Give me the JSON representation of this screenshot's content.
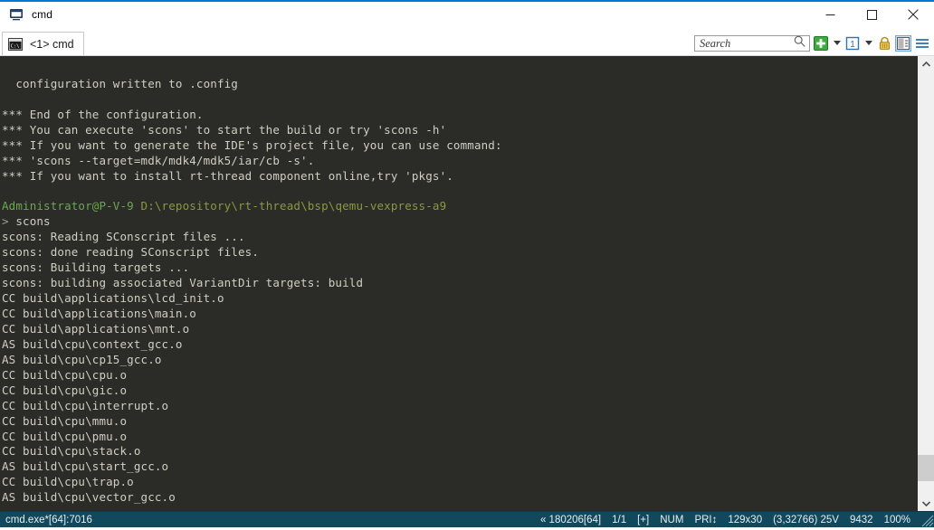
{
  "window": {
    "title": "cmd",
    "title_icon": "console-icon",
    "controls": {
      "minimize": "minimize-icon",
      "maximize": "maximize-icon",
      "close": "close-icon"
    }
  },
  "tabs": [
    {
      "label": "<1> cmd",
      "icon": "console-tab-icon",
      "active": true
    }
  ],
  "toolbar": {
    "search": {
      "placeholder": "Search",
      "value": "",
      "icon": "search-icon"
    },
    "new_console": {
      "icon": "green-plus-icon",
      "dropdown": "chevron-down-icon"
    },
    "active_console": {
      "label": "1",
      "icon": "console-number-icon",
      "dropdown": "chevron-down-icon"
    },
    "lock": {
      "icon": "lock-icon"
    },
    "panels": {
      "icon": "split-panel-icon",
      "selected": true
    },
    "menu": {
      "icon": "hamburger-menu-icon"
    }
  },
  "terminal": {
    "background": "#2b2b28",
    "foreground": "#cfcfc2",
    "prompt_color": "#6aa84f",
    "lines": [
      {
        "segments": [
          {
            "text": "",
            "class": "c-default"
          }
        ]
      },
      {
        "segments": [
          {
            "text": "  configuration written to .config",
            "class": "c-default"
          }
        ]
      },
      {
        "segments": [
          {
            "text": "",
            "class": "c-default"
          }
        ]
      },
      {
        "segments": [
          {
            "text": "*** End of the configuration.",
            "class": "c-default"
          }
        ]
      },
      {
        "segments": [
          {
            "text": "*** You can execute 'scons' to start the build or try 'scons -h'",
            "class": "c-default"
          }
        ]
      },
      {
        "segments": [
          {
            "text": "*** If you want to generate the IDE's project file, you can use command:",
            "class": "c-default"
          }
        ]
      },
      {
        "segments": [
          {
            "text": "*** 'scons --target=mdk/mdk4/mdk5/iar/cb -s'.",
            "class": "c-default"
          }
        ]
      },
      {
        "segments": [
          {
            "text": "*** If you want to install rt-thread component online,try 'pkgs'.",
            "class": "c-default"
          }
        ]
      },
      {
        "segments": [
          {
            "text": "",
            "class": "c-default"
          }
        ]
      },
      {
        "segments": [
          {
            "text": "Administrator@P-V-9",
            "class": "c-green"
          },
          {
            "text": " ",
            "class": "c-default"
          },
          {
            "text": "D:\\repository\\rt-thread\\bsp\\qemu-vexpress-a9",
            "class": "c-olive"
          }
        ]
      },
      {
        "segments": [
          {
            "text": "> ",
            "class": "c-gray"
          },
          {
            "text": "scons",
            "class": "c-default"
          }
        ]
      },
      {
        "segments": [
          {
            "text": "scons: Reading SConscript files ...",
            "class": "c-default"
          }
        ]
      },
      {
        "segments": [
          {
            "text": "scons: done reading SConscript files.",
            "class": "c-default"
          }
        ]
      },
      {
        "segments": [
          {
            "text": "scons: Building targets ...",
            "class": "c-default"
          }
        ]
      },
      {
        "segments": [
          {
            "text": "scons: building associated VariantDir targets: build",
            "class": "c-default"
          }
        ]
      },
      {
        "segments": [
          {
            "text": "CC build\\applications\\lcd_init.o",
            "class": "c-default"
          }
        ]
      },
      {
        "segments": [
          {
            "text": "CC build\\applications\\main.o",
            "class": "c-default"
          }
        ]
      },
      {
        "segments": [
          {
            "text": "CC build\\applications\\mnt.o",
            "class": "c-default"
          }
        ]
      },
      {
        "segments": [
          {
            "text": "AS build\\cpu\\context_gcc.o",
            "class": "c-default"
          }
        ]
      },
      {
        "segments": [
          {
            "text": "AS build\\cpu\\cp15_gcc.o",
            "class": "c-default"
          }
        ]
      },
      {
        "segments": [
          {
            "text": "CC build\\cpu\\cpu.o",
            "class": "c-default"
          }
        ]
      },
      {
        "segments": [
          {
            "text": "CC build\\cpu\\gic.o",
            "class": "c-default"
          }
        ]
      },
      {
        "segments": [
          {
            "text": "CC build\\cpu\\interrupt.o",
            "class": "c-default"
          }
        ]
      },
      {
        "segments": [
          {
            "text": "CC build\\cpu\\mmu.o",
            "class": "c-default"
          }
        ]
      },
      {
        "segments": [
          {
            "text": "CC build\\cpu\\pmu.o",
            "class": "c-default"
          }
        ]
      },
      {
        "segments": [
          {
            "text": "CC build\\cpu\\stack.o",
            "class": "c-default"
          }
        ]
      },
      {
        "segments": [
          {
            "text": "AS build\\cpu\\start_gcc.o",
            "class": "c-default"
          }
        ]
      },
      {
        "segments": [
          {
            "text": "CC build\\cpu\\trap.o",
            "class": "c-default"
          }
        ]
      },
      {
        "segments": [
          {
            "text": "AS build\\cpu\\vector_gcc.o",
            "class": "c-default"
          }
        ]
      }
    ]
  },
  "scrollbar": {
    "up_icon": "chevron-up-icon",
    "down_icon": "chevron-down-icon"
  },
  "statusbar": {
    "background": "#11485c",
    "process": "cmd.exe*[64]:7016",
    "cells": [
      {
        "name": "build-number",
        "text": "« 180206[64]"
      },
      {
        "name": "console-index",
        "text": "1/1"
      },
      {
        "name": "buffer-flag",
        "text": "[+]"
      },
      {
        "name": "num-lock",
        "text": "NUM"
      },
      {
        "name": "priority",
        "text": "PRI↕"
      },
      {
        "name": "console-size",
        "text": "129x30"
      },
      {
        "name": "cursor-position",
        "text": "(3,32766) 25V"
      },
      {
        "name": "memory",
        "text": "9432"
      },
      {
        "name": "zoom",
        "text": "100%"
      }
    ]
  }
}
